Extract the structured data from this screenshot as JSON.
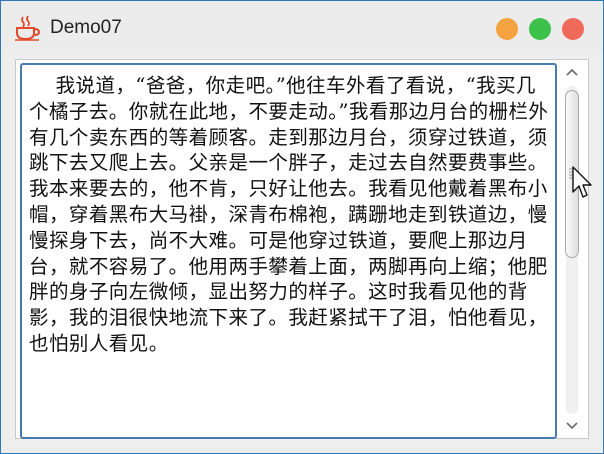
{
  "window": {
    "title": "Demo07",
    "app_icon": "coffee-cup-icon",
    "buttons": [
      {
        "name": "minimize-button",
        "color": "#f5a340"
      },
      {
        "name": "maximize-button",
        "color": "#3cc24a"
      },
      {
        "name": "close-button",
        "color": "#f06a5a"
      }
    ]
  },
  "textarea": {
    "content": "    我说道，“爸爸，你走吧。”他往车外看了看说，“我买几个橘子去。你就在此地，不要走动。”我看那边月台的栅栏外有几个卖东西的等着顾客。走到那边月台，须穿过铁道，须跳下去又爬上去。父亲是一个胖子，走过去自然要费事些。我本来要去的，他不肯，只好让他去。我看见他戴着黑布小帽，穿着黑布大马褂，深青布棉袍，蹒跚地走到铁道边，慢慢探身下去，尚不大难。可是他穿过铁道，要爬上那边月台，就不容易了。他用两手攀着上面，两脚再向上缩；他肥胖的身子向左微倾，显出努力的样子。这时我看见他的背影，我的泪很快地流下来了。我赶紧拭干了泪，怕他看见，也怕别人看见。"
  },
  "scrollbar": {
    "up_icon": "chevron-up-icon",
    "down_icon": "chevron-down-icon",
    "thumb_color": "#e4e4e4"
  },
  "colors": {
    "window_border": "#2f78b8",
    "textarea_border": "#4a7ab4",
    "background": "#eeeeee"
  }
}
